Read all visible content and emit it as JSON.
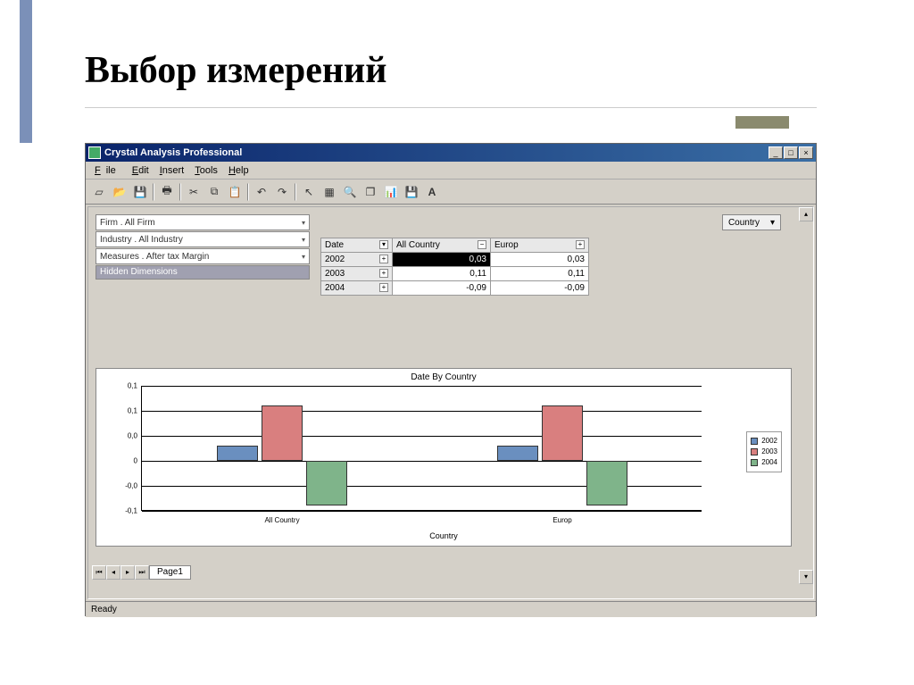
{
  "slide": {
    "title": "Выбор измерений"
  },
  "window": {
    "title": "Crystal Analysis Professional"
  },
  "menu": {
    "file": "File",
    "edit": "Edit",
    "insert": "Insert",
    "tools": "Tools",
    "help": "Help"
  },
  "dimensions": {
    "firm": "Firm . All Firm",
    "industry": "Industry . All Industry",
    "measures": "Measures . After tax Margin",
    "hidden": "Hidden Dimensions"
  },
  "grid": {
    "country_chip": "Country",
    "col_date": "Date",
    "col_all": "All Country",
    "col_europ": "Europ",
    "rows": [
      {
        "year": "2002",
        "all": "0,03",
        "europ": "0,03"
      },
      {
        "year": "2003",
        "all": "0,11",
        "europ": "0,11"
      },
      {
        "year": "2004",
        "all": "-0,09",
        "europ": "-0,09"
      }
    ]
  },
  "chart_data": {
    "type": "bar",
    "title": "Date By Country",
    "xlabel": "Country",
    "ylabel": "",
    "ylim": [
      -0.1,
      0.15
    ],
    "yticks": [
      -0.1,
      -0.05,
      0,
      0.05,
      0.1,
      0.15
    ],
    "ytick_labels": [
      "-0,1",
      "-0,0",
      "0",
      "0,0",
      "0,1",
      "0,1"
    ],
    "categories": [
      "All Country",
      "Europ"
    ],
    "series": [
      {
        "name": "2002",
        "color": "#6a8fbf",
        "values": [
          0.03,
          0.03
        ]
      },
      {
        "name": "2003",
        "color": "#d97f7f",
        "values": [
          0.11,
          0.11
        ]
      },
      {
        "name": "2004",
        "color": "#7fb48a",
        "values": [
          -0.09,
          -0.09
        ]
      }
    ]
  },
  "pager": {
    "page1": "Page1"
  },
  "status": {
    "ready": "Ready"
  }
}
